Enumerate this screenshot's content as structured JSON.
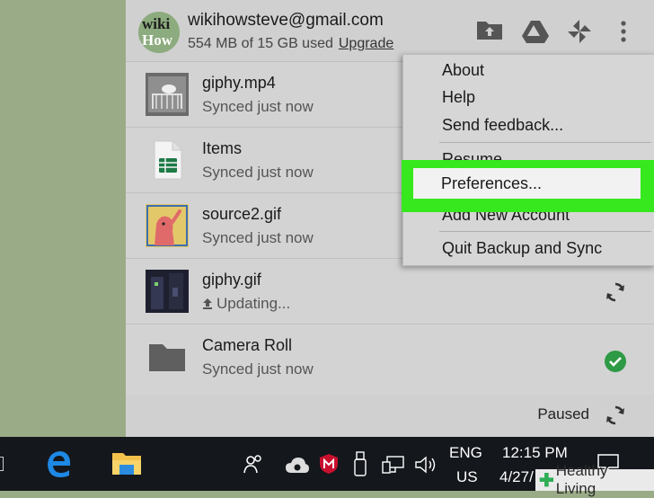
{
  "account": {
    "avatar_line1": "wiki",
    "avatar_line2": "How",
    "email": "wikihowsteve@gmail.com",
    "storage": "554 MB of 15 GB used",
    "upgrade_label": "Upgrade"
  },
  "header_icons": [
    "folder-icon",
    "google-drive-icon",
    "google-photos-icon",
    "more-vert-icon"
  ],
  "files": [
    {
      "name": "giphy.mp4",
      "status": "Synced just now",
      "thumb": "video-thumbnail",
      "state": "synced"
    },
    {
      "name": "Items",
      "status": "Synced just now",
      "thumb": "sheets-icon",
      "state": "synced"
    },
    {
      "name": "source2.gif",
      "status": "Synced just now",
      "thumb": "gif-thumbnail",
      "state": "synced"
    },
    {
      "name": "giphy.gif",
      "status": "Updating...",
      "thumb": "dark-gif-thumbnail",
      "state": "syncing"
    },
    {
      "name": "Camera Roll",
      "status": "Synced just now",
      "thumb": "folder-icon",
      "state": "done"
    }
  ],
  "footer": {
    "status": "Paused"
  },
  "menu": {
    "items": [
      "About",
      "Help",
      "Send feedback...",
      "Resume",
      "Preferences...",
      "Add New Account",
      "Quit Backup and Sync"
    ],
    "highlighted": "Preferences..."
  },
  "taskbar": {
    "language_top": "ENG",
    "language_bottom": "US",
    "time": "12:15 PM",
    "date": "4/27/",
    "icons": [
      "edge-icon",
      "file-explorer-icon",
      "people-icon",
      "backup-sync-icon",
      "mcafee-icon",
      "usb-icon",
      "network-icon",
      "volume-icon",
      "notifications-icon"
    ]
  },
  "watermark": "Healthy Living",
  "colors": {
    "highlight": "#37e81f",
    "check": "#2e9a45"
  }
}
